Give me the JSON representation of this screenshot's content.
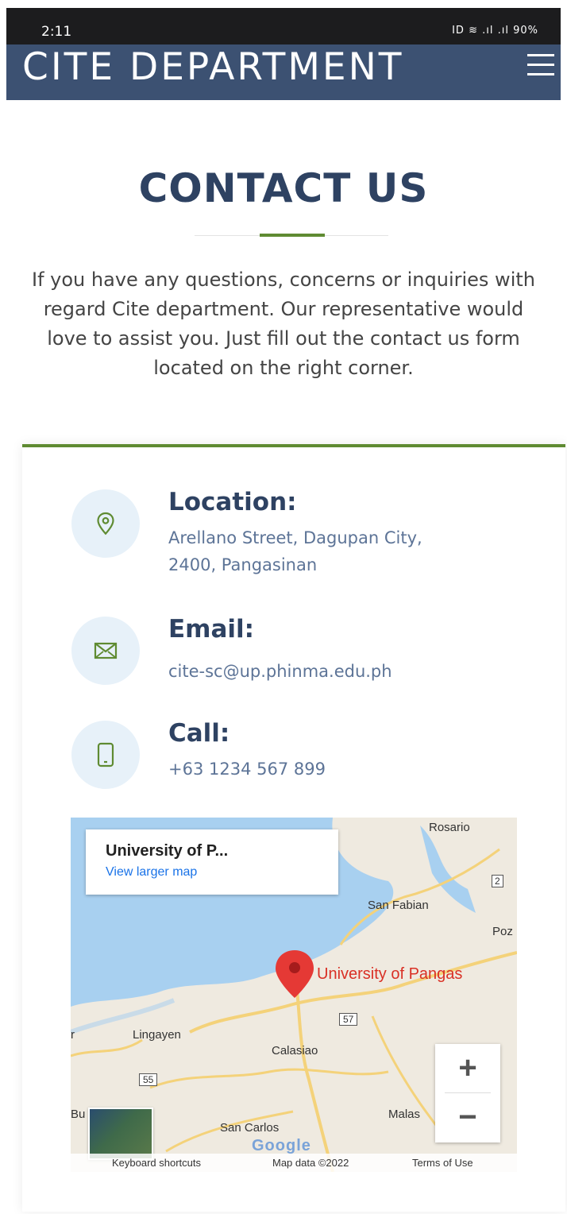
{
  "status": {
    "time": "2:11",
    "battery": "90%",
    "icons": "ID ≋ .ıl .ıl"
  },
  "header": {
    "brand": "CITE DEPARTMENT"
  },
  "contact": {
    "title": "CONTACT US",
    "intro": "If you have any questions, concerns or inquiries with regard Cite department. Our representative would love to assist you. Just fill out the contact us form located on the right corner.",
    "items": [
      {
        "heading": "Location:",
        "lines": [
          "Arellano Street, Dagupan City,",
          "2400, Pangasinan"
        ],
        "icon": "map-pin-icon"
      },
      {
        "heading": "Email:",
        "lines": [
          "cite-sc@up.phinma.edu.ph"
        ],
        "icon": "envelope-icon"
      },
      {
        "heading": "Call:",
        "lines": [
          "+63 1234 567 899"
        ],
        "icon": "phone-icon"
      }
    ]
  },
  "map": {
    "place_title": "University of P...",
    "view_larger": "View larger map",
    "pin_label": "University of Pangas",
    "labels": {
      "rosario": "Rosario",
      "san_fabian": "San Fabian",
      "poz": "Poz",
      "lingayen": "Lingayen",
      "calasiao": "Calasiao",
      "san_carlos": "San Carlos",
      "malas": "Malas",
      "bu": "Bu",
      "r": "r",
      "route_2": "2",
      "route_57": "57",
      "route_55": "55"
    },
    "zoom_in": "+",
    "zoom_out": "−",
    "google": "Google",
    "footer": {
      "shortcuts": "Keyboard shortcuts",
      "data": "Map data ©2022",
      "terms": "Terms of Use"
    }
  }
}
